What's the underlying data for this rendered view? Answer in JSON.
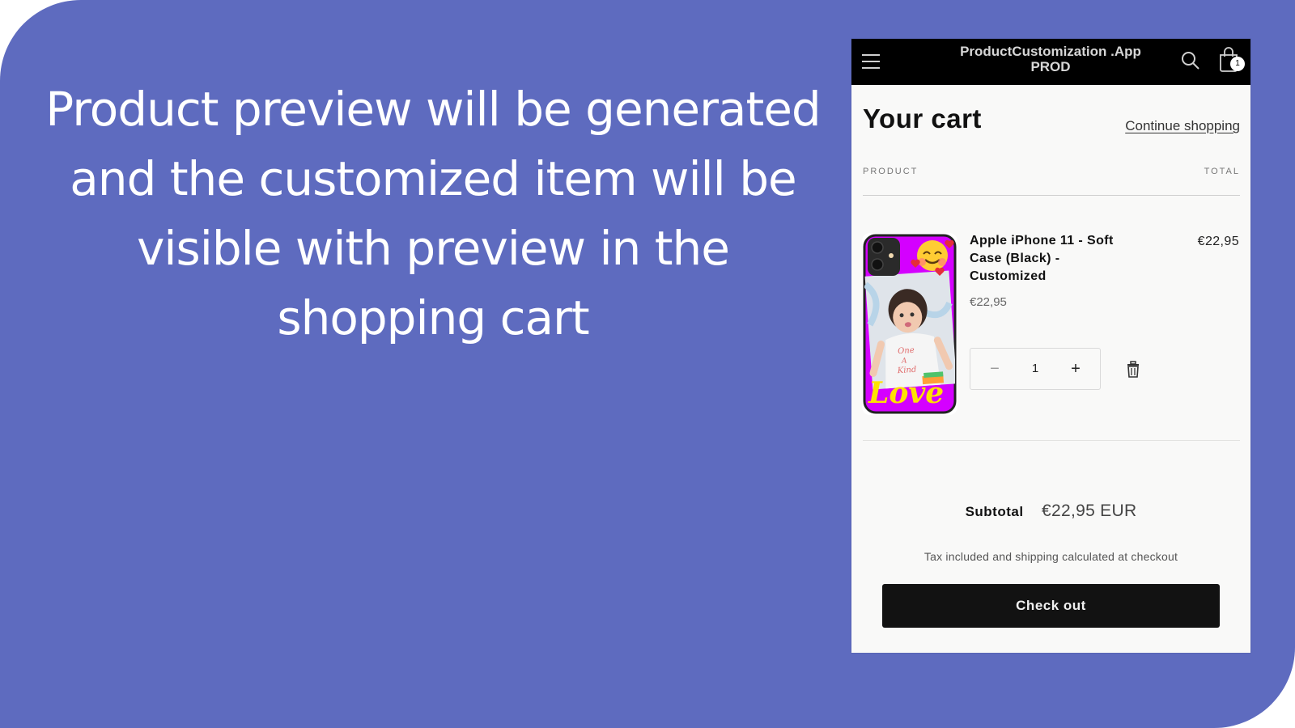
{
  "headline": "Product preview will be generated and the customized item will be visible with preview in the shopping cart",
  "colors": {
    "background": "#5e6bbf",
    "topbar": "#000000",
    "panel": "#f9f9f8",
    "checkout_button": "#121212",
    "case_color": "#d400ff",
    "love_text": "#ffe100"
  },
  "store": {
    "title": "ProductCustomization .App PROD",
    "icons": [
      "menu-icon",
      "search-icon",
      "bag-icon"
    ],
    "cart_count": "1"
  },
  "cart": {
    "title": "Your cart",
    "continue_label": "Continue shopping",
    "columns": {
      "product": "PRODUCT",
      "total": "TOTAL"
    },
    "items": [
      {
        "name": "Apple iPhone 11 - Soft Case (Black) - Customized",
        "price": "€22,95",
        "total": "€22,95",
        "quantity": "1",
        "thumbnail_text": "Love",
        "shirt_text": "One of a Kind"
      }
    ],
    "quantity_controls": {
      "decrease": "−",
      "increase": "+"
    },
    "subtotal_label": "Subtotal",
    "subtotal_value": "€22,95 EUR",
    "tax_note": "Tax included and shipping calculated at checkout",
    "checkout_label": "Check out"
  }
}
